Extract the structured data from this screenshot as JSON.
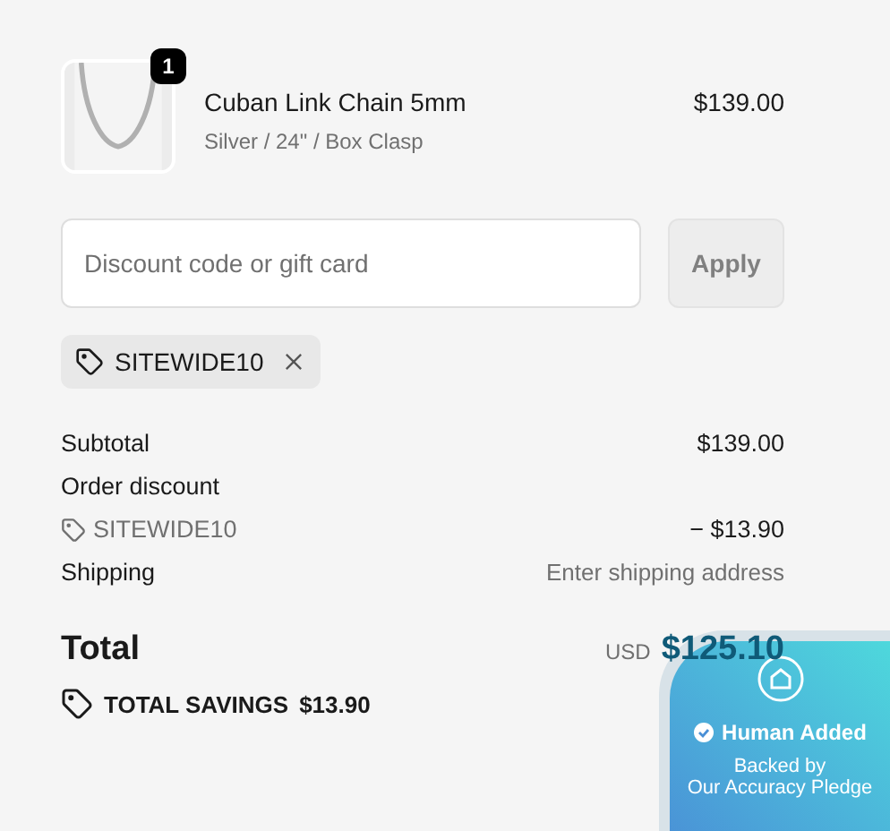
{
  "line_item": {
    "quantity": "1",
    "name": "Cuban Link Chain 5mm",
    "variant": "Silver / 24\" / Box Clasp",
    "price": "$139.00"
  },
  "discount_form": {
    "placeholder": "Discount code or gift card",
    "button": "Apply"
  },
  "applied_codes": [
    {
      "code": "SITEWIDE10"
    }
  ],
  "summary": [
    {
      "kind": "line",
      "label": "Subtotal",
      "value": "$139.00"
    },
    {
      "kind": "heading",
      "label": "Order discount"
    },
    {
      "kind": "discount",
      "label": "SITEWIDE10",
      "value": "− $13.90"
    },
    {
      "kind": "muted",
      "label": "Shipping",
      "value": "Enter shipping address"
    }
  ],
  "total": {
    "label": "Total",
    "currency": "USD",
    "amount": "$125.10"
  },
  "savings": {
    "label": "TOTAL SAVINGS",
    "amount": "$13.90"
  },
  "badge": {
    "title": "Human Added",
    "subtitle_1": "Backed by",
    "subtitle_2": "Our Accuracy Pledge"
  }
}
